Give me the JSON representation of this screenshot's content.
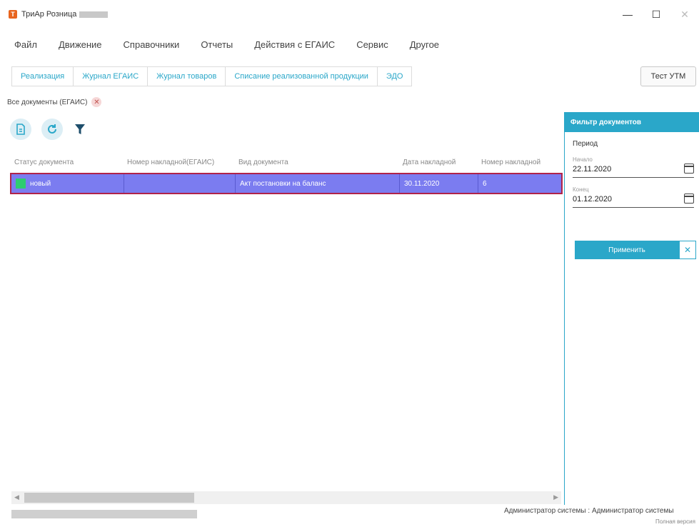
{
  "window": {
    "title": "ТриАр Розница"
  },
  "menu": [
    "Файл",
    "Движение",
    "Справочники",
    "Отчеты",
    "Действия с ЕГАИС",
    "Сервис",
    "Другое"
  ],
  "tabs": [
    "Реализация",
    "Журнал ЕГАИС",
    "Журнал товаров",
    "Списание реализованной продукции",
    "ЭДО"
  ],
  "test_button": "Тест УТМ",
  "doc_tab": "Все документы (ЕГАИС)",
  "grid": {
    "headers": [
      "Статус документа",
      "Номер накладной(ЕГАИС)",
      "Вид документа",
      "Дата накладной",
      "Номер накладной"
    ],
    "rows": [
      {
        "status": "новый",
        "egais_number": "",
        "doc_type": "Акт постановки на баланс",
        "date": "30.11.2020",
        "number": "6"
      }
    ]
  },
  "filter": {
    "title": "Фильтр документов",
    "period_label": "Период",
    "from_label": "Начало",
    "from_value": "22.11.2020",
    "to_label": "Конец",
    "to_value": "01.12.2020",
    "apply": "Применить"
  },
  "status_bar": {
    "user": "Администратор системы : Администратор системы",
    "version": "Полная версия"
  },
  "colors": {
    "accent": "#2aa7c9",
    "row_selected": "#7b7cf0",
    "row_border": "#b0234a",
    "status_new": "#2ecc71"
  }
}
